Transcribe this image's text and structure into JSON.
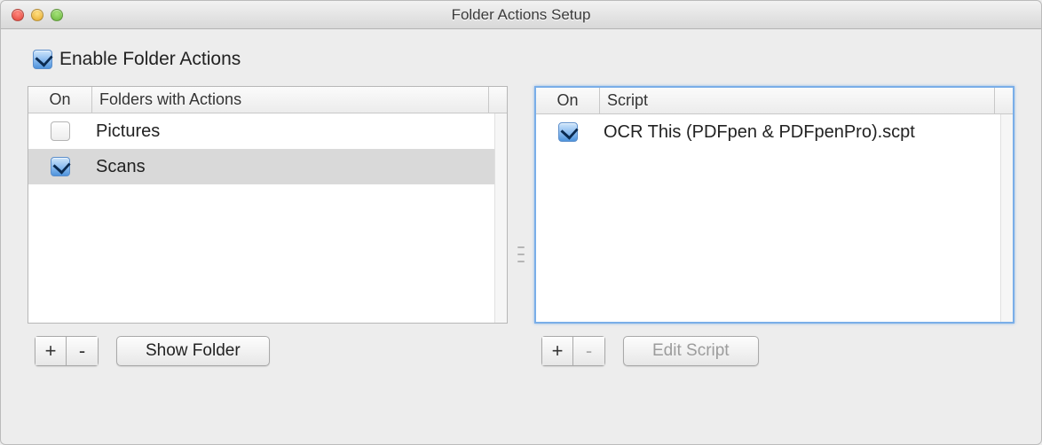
{
  "window": {
    "title": "Folder Actions Setup"
  },
  "enable": {
    "label": "Enable Folder Actions",
    "checked": true
  },
  "left": {
    "headers": {
      "on": "On",
      "main": "Folders with Actions"
    },
    "rows": [
      {
        "on": false,
        "label": "Pictures",
        "selected": false
      },
      {
        "on": true,
        "label": "Scans",
        "selected": true
      }
    ],
    "buttons": {
      "add": "+",
      "remove": "-",
      "show": "Show Folder",
      "remove_disabled": false
    }
  },
  "right": {
    "focused": true,
    "headers": {
      "on": "On",
      "main": "Script"
    },
    "rows": [
      {
        "on": true,
        "label": "OCR This (PDFpen & PDFpenPro).scpt",
        "selected": false
      }
    ],
    "buttons": {
      "add": "+",
      "remove": "-",
      "edit": "Edit Script",
      "remove_disabled": true,
      "edit_disabled": true
    }
  }
}
